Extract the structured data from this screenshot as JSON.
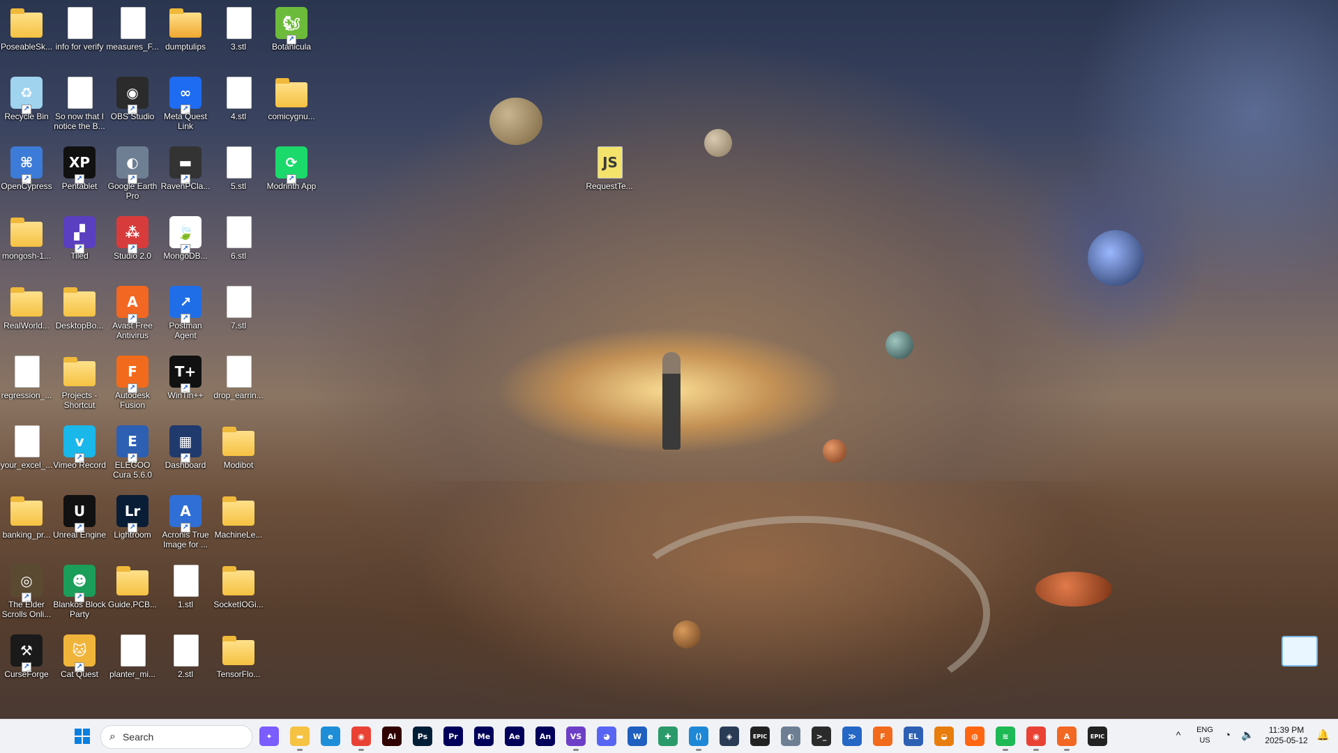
{
  "desktop": {
    "icons": [
      {
        "label": "PoseableSk...",
        "type": "folder",
        "color": "#f5c242",
        "glyph": ""
      },
      {
        "label": "info for verify",
        "type": "file",
        "color": "#ffffff",
        "glyph": ""
      },
      {
        "label": "measures_F...",
        "type": "file",
        "color": "#ffffff",
        "glyph": ""
      },
      {
        "label": "dumptulips",
        "type": "folder",
        "color": "#f0a830",
        "glyph": ""
      },
      {
        "label": "3.stl",
        "type": "file",
        "color": "#ffffff",
        "glyph": ""
      },
      {
        "label": "Botanicula",
        "type": "app",
        "color": "#6dbb3a",
        "glyph": "🐿"
      },
      {
        "label": "Recycle Bin",
        "type": "app",
        "color": "#9fd3ee",
        "glyph": "♻"
      },
      {
        "label": "So now that I notice the B...",
        "type": "file",
        "color": "#ffffff",
        "glyph": ""
      },
      {
        "label": "OBS Studio",
        "type": "app",
        "color": "#2b2b2b",
        "glyph": "◉"
      },
      {
        "label": "Meta Quest Link",
        "type": "app",
        "color": "#1d6cf2",
        "glyph": "∞"
      },
      {
        "label": "4.stl",
        "type": "file",
        "color": "#ffffff",
        "glyph": ""
      },
      {
        "label": "comicygnu...",
        "type": "folder",
        "color": "#f5c242",
        "glyph": ""
      },
      {
        "label": "OpenCypress",
        "type": "app",
        "color": "#3d7bd8",
        "glyph": "⌘"
      },
      {
        "label": "Pentablet",
        "type": "app",
        "color": "#111111",
        "glyph": "XP"
      },
      {
        "label": "Google Earth Pro",
        "type": "app",
        "color": "#6e7f93",
        "glyph": "◐"
      },
      {
        "label": "RavenPCla...",
        "type": "app",
        "color": "#333333",
        "glyph": "▬"
      },
      {
        "label": "5.stl",
        "type": "file",
        "color": "#ffffff",
        "glyph": ""
      },
      {
        "label": "Modrinth App",
        "type": "app",
        "color": "#1bd96a",
        "glyph": "⟳"
      },
      {
        "label": "mongosh-1...",
        "type": "folder",
        "color": "#f5c242",
        "glyph": ""
      },
      {
        "label": "Tiled",
        "type": "app",
        "color": "#5a3fc0",
        "glyph": "▞"
      },
      {
        "label": "Studio 2.0",
        "type": "app",
        "color": "#d83b3b",
        "glyph": "⁂"
      },
      {
        "label": "MongoDB...",
        "type": "app",
        "color": "#ffffff",
        "glyph": "🍃"
      },
      {
        "label": "6.stl",
        "type": "file",
        "color": "#ffffff",
        "glyph": ""
      },
      {
        "label": "RealWorld...",
        "type": "folder",
        "color": "#f5c242",
        "glyph": ""
      },
      {
        "label": "DesktopBo...",
        "type": "folder",
        "color": "#f5c242",
        "glyph": ""
      },
      {
        "label": "Avast Free Antivirus",
        "type": "app",
        "color": "#f26722",
        "glyph": "A"
      },
      {
        "label": "Postman Agent",
        "type": "app",
        "color": "#1f6ee8",
        "glyph": "↗"
      },
      {
        "label": "7.stl",
        "type": "file",
        "color": "#ffffff",
        "glyph": ""
      },
      {
        "label": "regression_...",
        "type": "file",
        "color": "#ffffff",
        "glyph": ""
      },
      {
        "label": "Projects - Shortcut",
        "type": "folder",
        "color": "#f5c242",
        "glyph": ""
      },
      {
        "label": "Autodesk Fusion",
        "type": "app",
        "color": "#f26a1b",
        "glyph": "F"
      },
      {
        "label": "WinTin++",
        "type": "app",
        "color": "#111111",
        "glyph": "T+"
      },
      {
        "label": "drop_earrin...",
        "type": "file",
        "color": "#ffffff",
        "glyph": ""
      },
      {
        "label": "your_excel_...",
        "type": "file",
        "color": "#ffffff",
        "glyph": ""
      },
      {
        "label": "Vimeo Record",
        "type": "app",
        "color": "#19b7ea",
        "glyph": "v"
      },
      {
        "label": "ELEGOO Cura 5.6.0",
        "type": "app",
        "color": "#2d5fb3",
        "glyph": "E"
      },
      {
        "label": "Dashboard",
        "type": "app",
        "color": "#203a6e",
        "glyph": "▦"
      },
      {
        "label": "Modibot",
        "type": "folder",
        "color": "#f5c242",
        "glyph": ""
      },
      {
        "label": "banking_pr...",
        "type": "folder",
        "color": "#f5c242",
        "glyph": ""
      },
      {
        "label": "Unreal Engine",
        "type": "app",
        "color": "#111111",
        "glyph": "U"
      },
      {
        "label": "Lightroom",
        "type": "app",
        "color": "#0a1d36",
        "glyph": "Lr"
      },
      {
        "label": "Acronis True Image for ...",
        "type": "app",
        "color": "#2f6fd6",
        "glyph": "A"
      },
      {
        "label": "MachineLe...",
        "type": "folder",
        "color": "#f5c242",
        "glyph": ""
      },
      {
        "label": "The Elder Scrolls Onli...",
        "type": "app",
        "color": "#5a4a32",
        "glyph": "◎"
      },
      {
        "label": "Blankos Block Party",
        "type": "app",
        "color": "#1a9e5a",
        "glyph": "☻"
      },
      {
        "label": "Guide,PCB...",
        "type": "folder",
        "color": "#f5c242",
        "glyph": ""
      },
      {
        "label": "1.stl",
        "type": "file",
        "color": "#ffffff",
        "glyph": ""
      },
      {
        "label": "SocketIOGi...",
        "type": "folder",
        "color": "#f5c242",
        "glyph": ""
      },
      {
        "label": "CurseForge",
        "type": "app",
        "color": "#1a1a1a",
        "glyph": "⚒"
      },
      {
        "label": "Cat Quest",
        "type": "app",
        "color": "#f0b43a",
        "glyph": "🐱"
      },
      {
        "label": "planter_mi...",
        "type": "file",
        "color": "#ffffff",
        "glyph": ""
      },
      {
        "label": "2.stl",
        "type": "file",
        "color": "#ffffff",
        "glyph": ""
      },
      {
        "label": "TensorFlo...",
        "type": "folder",
        "color": "#f5c242",
        "glyph": ""
      },
      {
        "label": "RequestTe...",
        "type": "file",
        "color": "#ffffff",
        "glyph": "JS"
      }
    ]
  },
  "taskbar": {
    "start_icon": "windows-start-icon",
    "search": {
      "placeholder": "Search"
    },
    "apps": [
      {
        "name": "copilot-icon",
        "abbr": "✦",
        "color": "#7b5cff"
      },
      {
        "name": "file-explorer-icon",
        "abbr": "▬",
        "color": "#f5c242"
      },
      {
        "name": "edge-icon",
        "abbr": "e",
        "color": "#1f8ed8"
      },
      {
        "name": "chrome-icon",
        "abbr": "◉",
        "color": "#e94235"
      },
      {
        "name": "illustrator-icon",
        "abbr": "Ai",
        "color": "#300000"
      },
      {
        "name": "photoshop-icon",
        "abbr": "Ps",
        "color": "#001e36"
      },
      {
        "name": "premiere-icon",
        "abbr": "Pr",
        "color": "#00005b"
      },
      {
        "name": "media-encoder-icon",
        "abbr": "Me",
        "color": "#00005b"
      },
      {
        "name": "after-effects-icon",
        "abbr": "Ae",
        "color": "#00005b"
      },
      {
        "name": "animate-icon",
        "abbr": "An",
        "color": "#00005b"
      },
      {
        "name": "visual-studio-icon",
        "abbr": "VS",
        "color": "#6d3fc7"
      },
      {
        "name": "discord-icon",
        "abbr": "◕",
        "color": "#5865f2"
      },
      {
        "name": "word-icon",
        "abbr": "W",
        "color": "#1f5fbf"
      },
      {
        "name": "graph-tool-icon",
        "abbr": "✚",
        "color": "#2a9a6a"
      },
      {
        "name": "vscode-icon",
        "abbr": "⟨⟩",
        "color": "#1e88d6"
      },
      {
        "name": "cube-app-icon",
        "abbr": "◈",
        "color": "#2a3b55"
      },
      {
        "name": "epic-games-icon",
        "abbr": "EPIC",
        "color": "#222222"
      },
      {
        "name": "google-earth-icon",
        "abbr": "◐",
        "color": "#6e7f93"
      },
      {
        "name": "terminal-icon",
        "abbr": ">_",
        "color": "#2b2b2b"
      },
      {
        "name": "powershell-icon",
        "abbr": "≫",
        "color": "#2467c4"
      },
      {
        "name": "fusion-icon",
        "abbr": "F",
        "color": "#f26a1b"
      },
      {
        "name": "elegoo-icon",
        "abbr": "EL",
        "color": "#2d5fb3"
      },
      {
        "name": "blender-icon",
        "abbr": "◒",
        "color": "#e87d0d"
      },
      {
        "name": "firefox-icon",
        "abbr": "◍",
        "color": "#ff6611"
      },
      {
        "name": "spotify-icon",
        "abbr": "≋",
        "color": "#1db954"
      },
      {
        "name": "chrome-profile-icon",
        "abbr": "◉",
        "color": "#e94235"
      },
      {
        "name": "avast-icon",
        "abbr": "A",
        "color": "#f26722"
      },
      {
        "name": "epic-games-icon-2",
        "abbr": "EPIC",
        "color": "#222222"
      }
    ],
    "tray": {
      "chevron": "^",
      "lang_top": "ENG",
      "lang_bottom": "US",
      "time": "11:39 PM",
      "date": "2025-05-12"
    }
  }
}
